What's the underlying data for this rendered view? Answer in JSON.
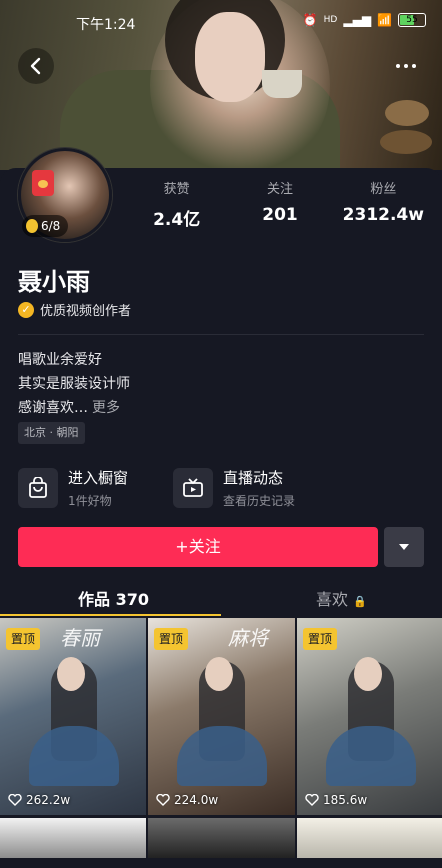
{
  "status_bar": {
    "time": "下午1:24",
    "network": "HD",
    "battery": "55"
  },
  "profile": {
    "name": "聂小雨",
    "certification": "优质视频创作者",
    "coin_counter": "6/8",
    "stats": [
      {
        "label": "获赞",
        "value": "2.4亿"
      },
      {
        "label": "关注",
        "value": "201"
      },
      {
        "label": "粉丝",
        "value": "2312.4w"
      }
    ],
    "bio_lines": [
      "唱歌业余爱好",
      "其实是服装设计师",
      "感谢喜欢…"
    ],
    "bio_more": "更多",
    "location": "北京 · 朝阳"
  },
  "shortcuts": [
    {
      "title": "进入橱窗",
      "subtitle": "1件好物",
      "icon": "shopping-bag-icon"
    },
    {
      "title": "直播动态",
      "subtitle": "查看历史记录",
      "icon": "tv-icon"
    }
  ],
  "actions": {
    "follow_label": "+关注"
  },
  "tabs": {
    "works": "作品 370",
    "likes": "喜欢"
  },
  "videos": [
    {
      "pinned": "置顶",
      "watermark": "春丽",
      "likes": "262.2w"
    },
    {
      "pinned": "置顶",
      "watermark": "麻将",
      "likes": "224.0w"
    },
    {
      "pinned": "置顶",
      "watermark": "",
      "likes": "185.6w"
    }
  ],
  "colors": {
    "accent": "#fe2c55",
    "background": "#161823",
    "tab_indicator": "#f4c430"
  }
}
